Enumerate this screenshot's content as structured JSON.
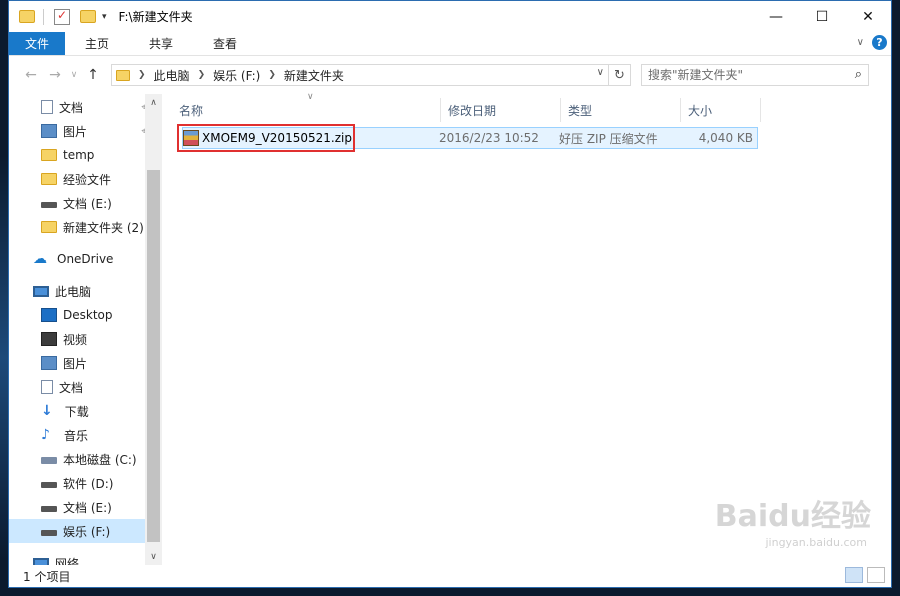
{
  "window": {
    "title": "F:\\新建文件夹",
    "controls": [
      "minimize",
      "maximize",
      "close"
    ]
  },
  "ribbon": {
    "tabs": [
      "文件",
      "主页",
      "共享",
      "查看"
    ]
  },
  "address": {
    "crumbs": [
      "此电脑",
      "娱乐 (F:)",
      "新建文件夹"
    ]
  },
  "search": {
    "placeholder": "搜索\"新建文件夹\""
  },
  "nav_pane": {
    "items": [
      {
        "label": "文档",
        "icon": "doc-icon",
        "pinned": true
      },
      {
        "label": "图片",
        "icon": "picture-icon",
        "pinned": true
      },
      {
        "label": "temp",
        "icon": "folder-icon"
      },
      {
        "label": "经验文件",
        "icon": "folder-icon"
      },
      {
        "label": "文档 (E:)",
        "icon": "drive-icon"
      },
      {
        "label": "新建文件夹 (2)",
        "icon": "folder-icon"
      },
      {
        "label": "OneDrive",
        "icon": "cloud-icon"
      },
      {
        "label": "此电脑",
        "icon": "computer-icon"
      },
      {
        "label": "Desktop",
        "icon": "desktop-icon"
      },
      {
        "label": "视频",
        "icon": "video-icon"
      },
      {
        "label": "图片",
        "icon": "picture-icon"
      },
      {
        "label": "文档",
        "icon": "doc-icon"
      },
      {
        "label": "下载",
        "icon": "download-icon"
      },
      {
        "label": "音乐",
        "icon": "music-icon"
      },
      {
        "label": "本地磁盘 (C:)",
        "icon": "system-drive-icon"
      },
      {
        "label": "软件 (D:)",
        "icon": "drive-icon"
      },
      {
        "label": "文档 (E:)",
        "icon": "drive-icon"
      },
      {
        "label": "娱乐 (F:)",
        "icon": "drive-icon",
        "selected": true
      },
      {
        "label": "网络",
        "icon": "network-icon"
      }
    ]
  },
  "columns": [
    "名称",
    "修改日期",
    "类型",
    "大小"
  ],
  "files": [
    {
      "name": "XMOEM9_V20150521.zip",
      "modified": "2016/2/23 10:52",
      "type": "好压 ZIP 压缩文件",
      "size": "4,040 KB"
    }
  ],
  "status": {
    "count": "1 个项目"
  },
  "watermark": {
    "brand": "Baidu经验",
    "url": "jingyan.baidu.com"
  }
}
